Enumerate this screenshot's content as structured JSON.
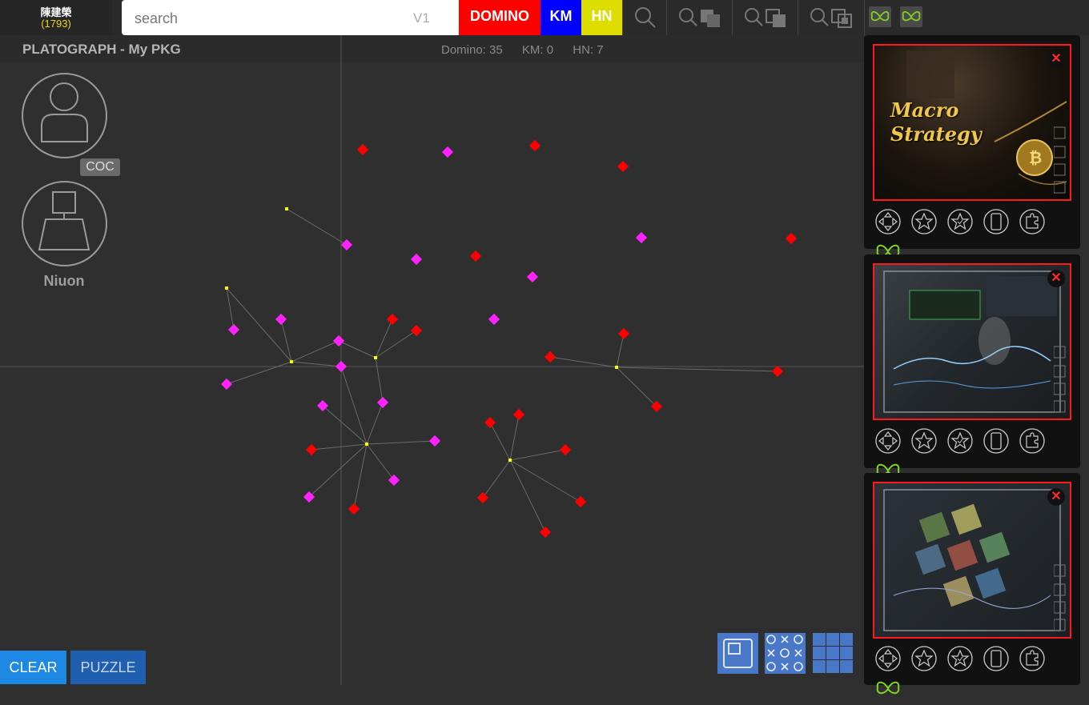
{
  "user": {
    "name": "陳建榮",
    "score": "(1793)"
  },
  "search": {
    "placeholder": "search",
    "version": "V1"
  },
  "filters": {
    "domino": "DOMINO",
    "km": "KM",
    "hn": "HN"
  },
  "colors": {
    "domino": "#ff0000",
    "km": "#0000ff",
    "hn": "#dddd00",
    "butterfly": "#7ed321",
    "accent": "#1e88e5"
  },
  "header": {
    "title": "PLATOGRAPH - My PKG",
    "domino_count": "Domino: 35",
    "km_count": "KM: 0",
    "hn_count": "HN: 7"
  },
  "profile": {
    "badge": "COC",
    "label": "Niuon"
  },
  "buttons": {
    "clear": "CLEAR",
    "puzzle": "PUZZLE"
  },
  "panels": [
    {
      "title_line1": "Macro",
      "title_line2": "Strategy"
    },
    {},
    {}
  ]
}
